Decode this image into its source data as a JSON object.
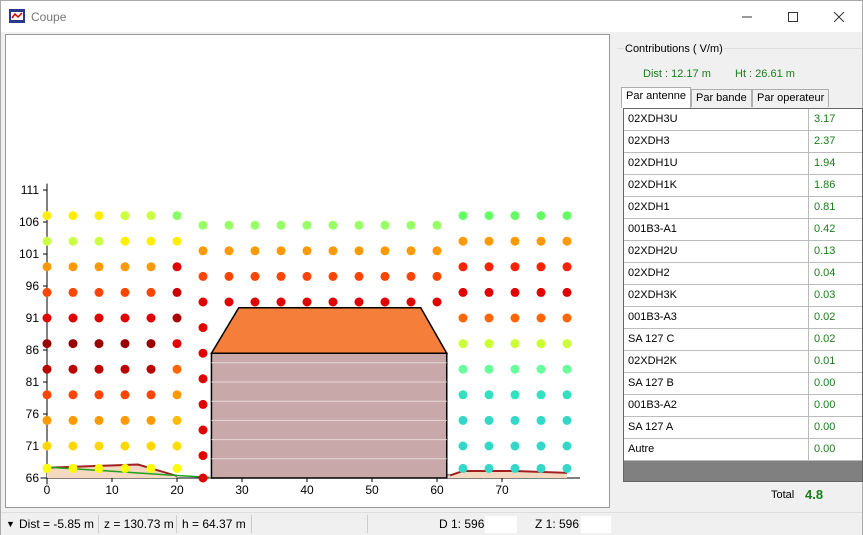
{
  "window": {
    "title": "Coupe"
  },
  "panel": {
    "group_title": "Contributions ( V/m)",
    "dist": "Dist : 12.17 m",
    "ht": "Ht : 26.61 m",
    "tabs": [
      "Par antenne",
      "Par bande",
      "Par operateur"
    ],
    "rows": [
      {
        "name": "02XDH3U",
        "value": "3.17"
      },
      {
        "name": "02XDH3",
        "value": "2.37"
      },
      {
        "name": "02XDH1U",
        "value": "1.94"
      },
      {
        "name": "02XDH1K",
        "value": "1.86"
      },
      {
        "name": "02XDH1",
        "value": "0.81"
      },
      {
        "name": "001B3-A1",
        "value": "0.42"
      },
      {
        "name": "02XDH2U",
        "value": "0.13"
      },
      {
        "name": "02XDH2",
        "value": "0.04"
      },
      {
        "name": "02XDH3K",
        "value": "0.03"
      },
      {
        "name": "001B3-A3",
        "value": "0.02"
      },
      {
        "name": "SA 127 C",
        "value": "0.02"
      },
      {
        "name": "02XDH2K",
        "value": "0.01"
      },
      {
        "name": "SA 127 B",
        "value": "0.00"
      },
      {
        "name": "001B3-A2",
        "value": "0.00"
      },
      {
        "name": "SA 127 A",
        "value": "0.00"
      },
      {
        "name": "Autre",
        "value": "0.00"
      }
    ],
    "total_label": "Total",
    "total_value": "4.8"
  },
  "status": {
    "dist": "Dist = -5.85 m",
    "z": "z = 130.73 m",
    "h": "h = 64.37 m",
    "d_scale": "D  1: 596",
    "z_scale": "Z  1: 596"
  },
  "plot": {
    "x_ticks": [
      "0",
      "10",
      "20",
      "30",
      "40",
      "50",
      "60",
      "70"
    ],
    "y_ticks": [
      "111",
      "106",
      "101",
      "96",
      "91",
      "86",
      "81",
      "76",
      "71",
      "66"
    ],
    "colors": {
      "building_roof": "#f57f3a",
      "building_wall": "#c8a8a8",
      "ground": "#f5d8c0"
    }
  }
}
